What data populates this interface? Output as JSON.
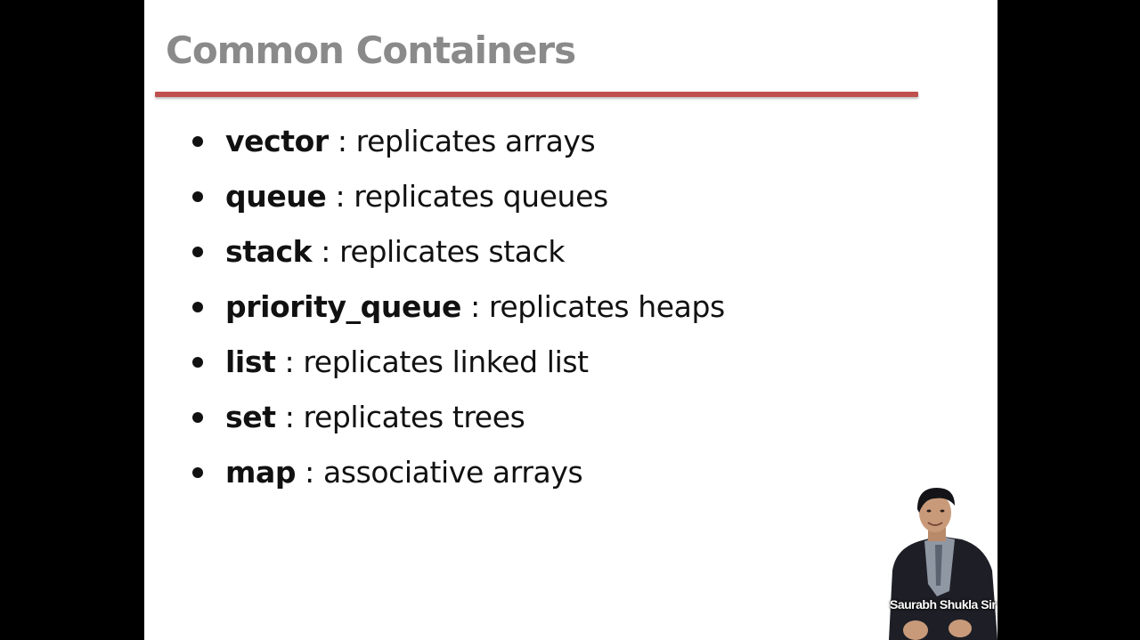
{
  "slide": {
    "title": "Common Containers",
    "title_color": "#8a8a8a",
    "rule_color": "#c0504d",
    "items": [
      {
        "term": "vector",
        "description": " : replicates arrays"
      },
      {
        "term": "queue",
        "description": " : replicates queues"
      },
      {
        "term": "stack",
        "description": " : replicates stack"
      },
      {
        "term": "priority_queue",
        "description": " : replicates heaps"
      },
      {
        "term": "list",
        "description": " : replicates linked list"
      },
      {
        "term": "set",
        "description": " : replicates trees"
      },
      {
        "term": "map",
        "description": " : associative arrays"
      }
    ]
  },
  "presenter": {
    "label": "Saurabh Shukla Sir"
  }
}
